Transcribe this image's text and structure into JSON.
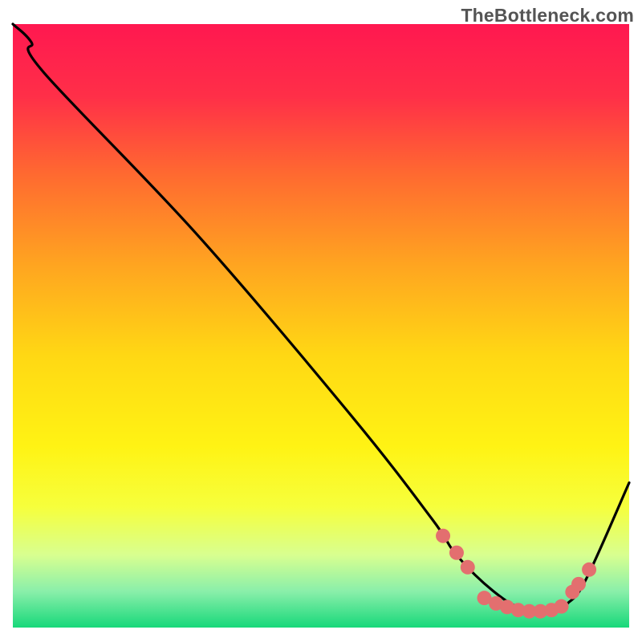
{
  "watermark": "TheBottleneck.com",
  "chart_data": {
    "type": "line",
    "title": "",
    "xlabel": "",
    "ylabel": "",
    "xlim": [
      0,
      100
    ],
    "ylim": [
      0,
      100
    ],
    "background_gradient": {
      "stops": [
        {
          "offset": 0.0,
          "color": "#ff1850"
        },
        {
          "offset": 0.12,
          "color": "#ff2f48"
        },
        {
          "offset": 0.25,
          "color": "#ff6a30"
        },
        {
          "offset": 0.4,
          "color": "#ffa520"
        },
        {
          "offset": 0.55,
          "color": "#ffd814"
        },
        {
          "offset": 0.7,
          "color": "#fff314"
        },
        {
          "offset": 0.8,
          "color": "#f6ff3c"
        },
        {
          "offset": 0.88,
          "color": "#d8ff90"
        },
        {
          "offset": 0.94,
          "color": "#8aefaa"
        },
        {
          "offset": 1.0,
          "color": "#17d87a"
        }
      ]
    },
    "curve": {
      "x": [
        0,
        3,
        5,
        30,
        55,
        68,
        72,
        78,
        83,
        88,
        90,
        93,
        100
      ],
      "y": [
        100,
        97,
        92,
        65,
        35,
        18,
        12,
        6,
        3,
        3,
        4,
        8,
        24
      ]
    },
    "markers": {
      "color": "#e36f6f",
      "radius": 9,
      "points": [
        {
          "x": 69.8,
          "y": 15.2
        },
        {
          "x": 72.0,
          "y": 12.4
        },
        {
          "x": 73.8,
          "y": 10.0
        },
        {
          "x": 76.5,
          "y": 4.9
        },
        {
          "x": 78.4,
          "y": 4.0
        },
        {
          "x": 80.2,
          "y": 3.4
        },
        {
          "x": 82.0,
          "y": 2.9
        },
        {
          "x": 83.8,
          "y": 2.7
        },
        {
          "x": 85.6,
          "y": 2.7
        },
        {
          "x": 87.4,
          "y": 2.9
        },
        {
          "x": 89.0,
          "y": 3.5
        },
        {
          "x": 90.8,
          "y": 5.9
        },
        {
          "x": 91.8,
          "y": 7.2
        },
        {
          "x": 93.5,
          "y": 9.6
        }
      ]
    }
  }
}
